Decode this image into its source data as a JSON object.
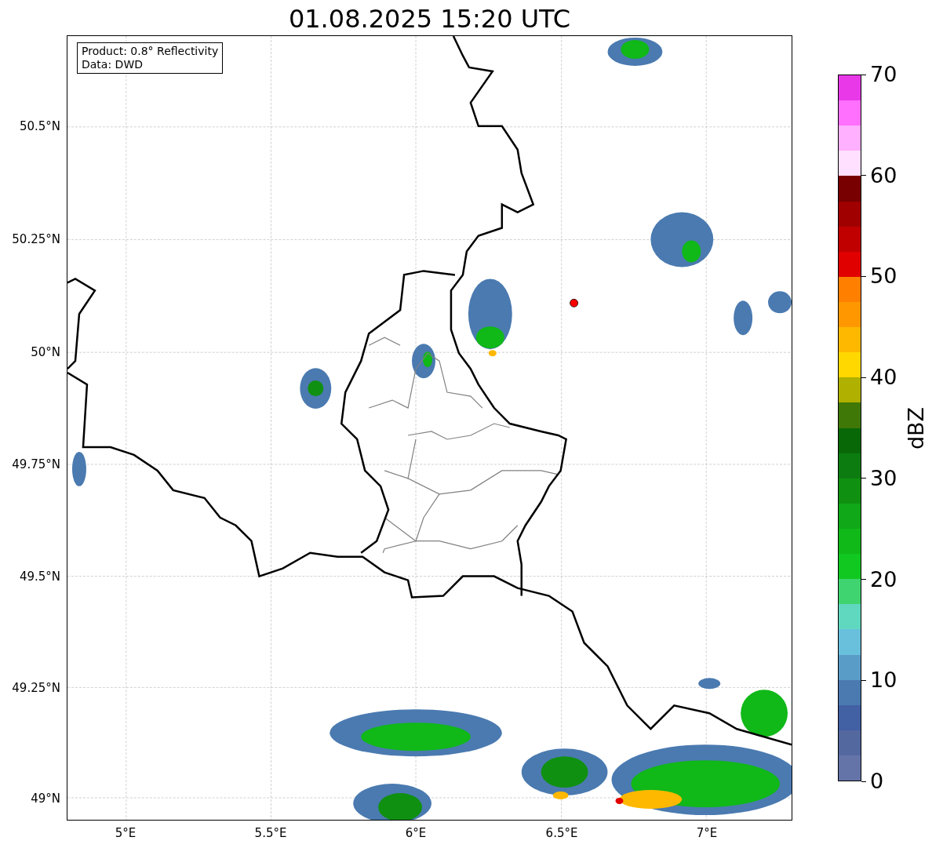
{
  "title": "01.08.2025 15:20 UTC",
  "legend": {
    "lines": [
      "Product: 0.8° Reflectivity",
      "Data: DWD"
    ]
  },
  "map": {
    "lat_ticks": [
      "50.5°N",
      "50.25°N",
      "50°N",
      "49.75°N",
      "49.5°N",
      "49.25°N",
      "49°N"
    ],
    "lon_ticks": [
      "5°E",
      "5.5°E",
      "6°E",
      "6.5°E",
      "7°E"
    ]
  },
  "colorbar": {
    "label": "dBZ",
    "ticks": [
      "70",
      "60",
      "50",
      "40",
      "30",
      "20",
      "10",
      "0"
    ],
    "bands": [
      {
        "color": "#e838e8"
      },
      {
        "color": "#ff70ff"
      },
      {
        "color": "#ffb0ff"
      },
      {
        "color": "#ffe0ff"
      },
      {
        "color": "#780000"
      },
      {
        "color": "#a00000"
      },
      {
        "color": "#c00000"
      },
      {
        "color": "#e00000"
      },
      {
        "color": "#ff8000"
      },
      {
        "color": "#ff9800"
      },
      {
        "color": "#ffb800"
      },
      {
        "color": "#ffd800"
      },
      {
        "color": "#b0b000"
      },
      {
        "color": "#407808"
      },
      {
        "color": "#086808"
      },
      {
        "color": "#0c7c10"
      },
      {
        "color": "#109010"
      },
      {
        "color": "#10a818"
      },
      {
        "color": "#10b818"
      },
      {
        "color": "#10c820"
      },
      {
        "color": "#40d470"
      },
      {
        "color": "#60d8c0"
      },
      {
        "color": "#68c0dc"
      },
      {
        "color": "#5a9cc8"
      },
      {
        "color": "#4a7ab0"
      },
      {
        "color": "#4260a4"
      },
      {
        "color": "#5468a0"
      },
      {
        "color": "#6474a8"
      }
    ]
  }
}
